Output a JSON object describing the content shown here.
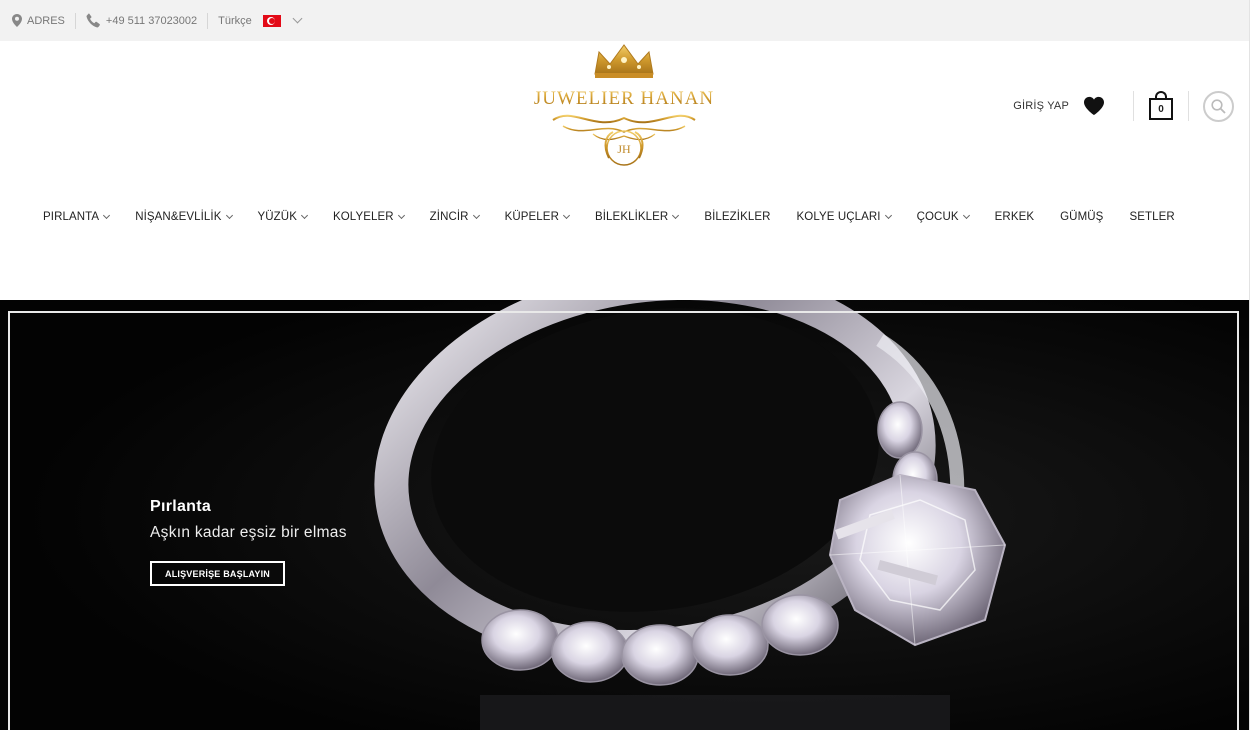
{
  "topbar": {
    "address_label": "ADRES",
    "phone": "+49 511 37023002",
    "language": "Türkçe"
  },
  "logo": {
    "brand_text": "JUWELIER HANAN",
    "monogram": "JH"
  },
  "header": {
    "login_label": "GİRİŞ YAP",
    "cart_count": "0"
  },
  "nav": {
    "items": [
      {
        "label": "PIRLANTA",
        "dropdown": true
      },
      {
        "label": "NİŞAN&EVLİLİK",
        "dropdown": true
      },
      {
        "label": "YÜZÜK",
        "dropdown": true
      },
      {
        "label": "KOLYELER",
        "dropdown": true
      },
      {
        "label": "ZİNCİR",
        "dropdown": true
      },
      {
        "label": "KÜPELER",
        "dropdown": true
      },
      {
        "label": "BİLEKLİKLER",
        "dropdown": true
      },
      {
        "label": "BİLEZİKLER",
        "dropdown": false
      },
      {
        "label": "KOLYE UÇLARI",
        "dropdown": true
      },
      {
        "label": "ÇOCUK",
        "dropdown": true
      },
      {
        "label": "ERKEK",
        "dropdown": false
      },
      {
        "label": "GÜMÜŞ",
        "dropdown": false
      },
      {
        "label": "SETLER",
        "dropdown": false
      }
    ]
  },
  "hero": {
    "title": "Pırlanta",
    "subtitle": "Aşkın kadar eşsiz bir elmas",
    "button_label": "ALIŞVERİŞE BAŞLAYIN"
  },
  "colors": {
    "topbar_bg": "#f2f2f2",
    "logo_gold": "#d4a23c",
    "hero_bg": "#050505"
  }
}
